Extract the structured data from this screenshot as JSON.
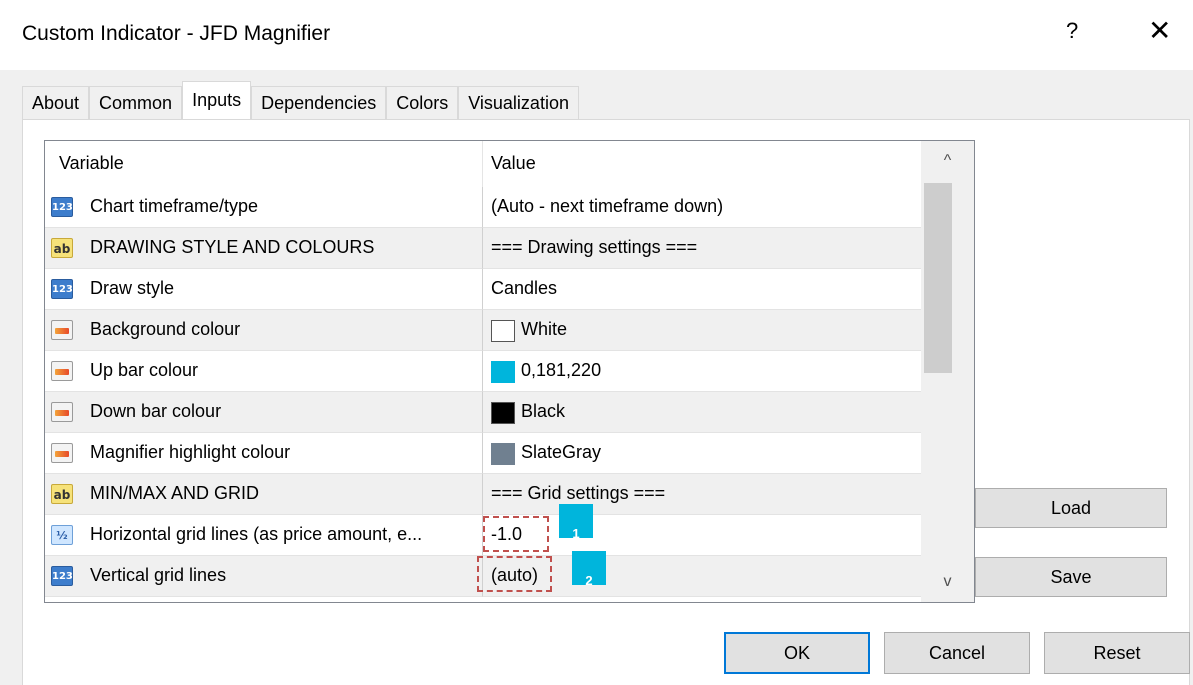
{
  "window": {
    "title": "Custom Indicator - JFD Magnifier",
    "help_label": "?",
    "close_label": "✕"
  },
  "tabs": [
    {
      "label": "About"
    },
    {
      "label": "Common"
    },
    {
      "label": "Inputs",
      "active": true
    },
    {
      "label": "Dependencies"
    },
    {
      "label": "Colors"
    },
    {
      "label": "Visualization"
    }
  ],
  "grid": {
    "col_variable": "Variable",
    "col_value": "Value",
    "rows": [
      {
        "icon": "integer-icon",
        "icon_text": "123",
        "name": "Chart timeframe/type",
        "value": "(Auto - next timeframe down)"
      },
      {
        "icon": "string-icon",
        "icon_text": "ab",
        "name": "DRAWING STYLE AND COLOURS",
        "value": "=== Drawing settings ==="
      },
      {
        "icon": "integer-icon",
        "icon_text": "123",
        "name": "Draw style",
        "value": "Candles"
      },
      {
        "icon": "color-icon",
        "name": "Background colour",
        "value": "White",
        "swatch": "#ffffff"
      },
      {
        "icon": "color-icon",
        "name": "Up bar colour",
        "value": "0,181,220",
        "swatch": "#00b5dc"
      },
      {
        "icon": "color-icon",
        "name": "Down bar colour",
        "value": "Black",
        "swatch": "#000000"
      },
      {
        "icon": "color-icon",
        "name": "Magnifier highlight colour",
        "value": "SlateGray",
        "swatch": "#708090"
      },
      {
        "icon": "string-icon",
        "icon_text": "ab",
        "name": "MIN/MAX AND GRID",
        "value": "=== Grid settings ==="
      },
      {
        "icon": "double-icon",
        "icon_text": "½",
        "name": "Horizontal grid lines (as price amount, e...",
        "value": "-1.0"
      },
      {
        "icon": "integer-icon",
        "icon_text": "123",
        "name": "Vertical grid lines",
        "value": "(auto)"
      }
    ]
  },
  "markers": [
    {
      "label": "1"
    },
    {
      "label": "2"
    }
  ],
  "scroll": {
    "up": "^",
    "down": "v"
  },
  "side_buttons": {
    "load": "Load",
    "save": "Save"
  },
  "buttons": {
    "ok": "OK",
    "cancel": "Cancel",
    "reset": "Reset"
  },
  "colors": {
    "accent": "#00b5dc",
    "highlight_border": "#c0504d",
    "default_button_border": "#0078d7"
  }
}
